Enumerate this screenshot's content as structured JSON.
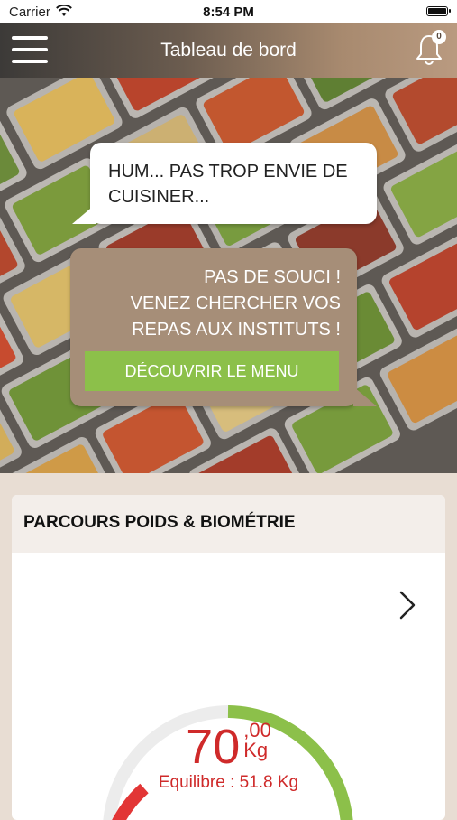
{
  "status_bar": {
    "carrier": "Carrier",
    "time": "8:54 PM"
  },
  "navbar": {
    "title": "Tableau de bord",
    "notification_count": "0"
  },
  "hero": {
    "bubble_question": "HUM... PAS TROP ENVIE DE CUISINER...",
    "bubble_answer_line1": "PAS DE SOUCI !",
    "bubble_answer_line2": "VENEZ CHERCHER VOS",
    "bubble_answer_line3": "REPAS AUX INSTITUTS !",
    "button_label": "DÉCOUVRIR LE MENU"
  },
  "weight_card": {
    "title": "PARCOURS POIDS & BIOMÉTRIE",
    "weight_integer": "70",
    "weight_decimal": ",00",
    "weight_unit": "Kg",
    "equilibrium_text": "Equilibre : 51.8 Kg"
  },
  "colors": {
    "accent_green": "#8cc04a",
    "accent_red": "#cf2a2a",
    "bubble_brown": "#a68e78"
  },
  "icons": [
    "menu-icon",
    "bell-icon",
    "wifi-icon",
    "battery-icon",
    "chevron-right-icon"
  ]
}
